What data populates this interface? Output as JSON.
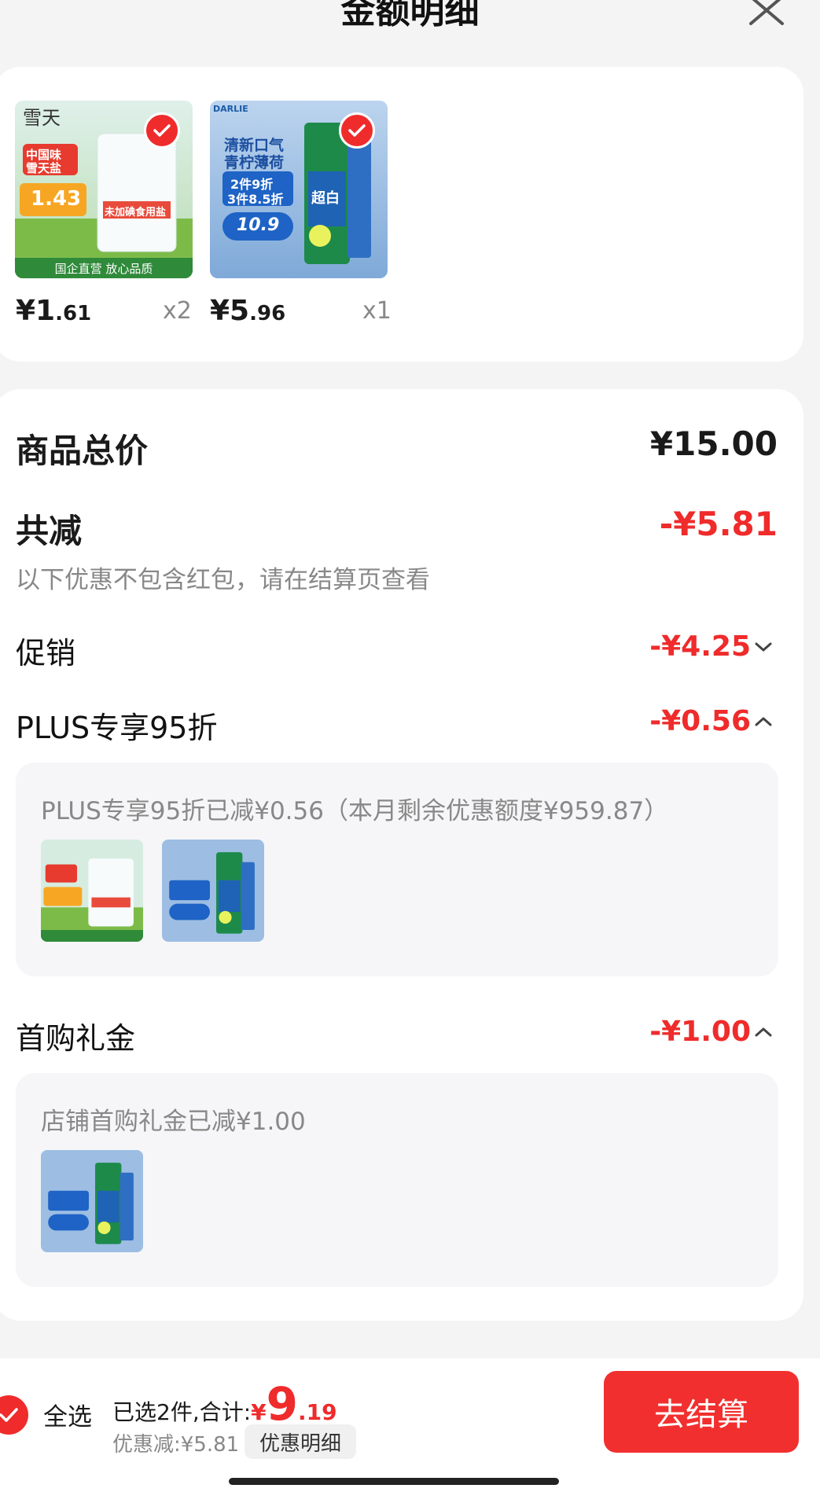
{
  "header": {
    "title": "金额明细"
  },
  "products": [
    {
      "price_int": "¥1",
      "price_dec": ".61",
      "qty": "x2"
    },
    {
      "price_int": "¥5",
      "price_dec": ".96",
      "qty": "x1"
    }
  ],
  "salt_art": {
    "brand": "雪天",
    "badge1": "中国味",
    "badge2": "雪天盐",
    "price": "1.43",
    "label": "未加碘食用盐",
    "footer": "国企直营 放心品质"
  },
  "paste_art": {
    "brand": "DARLIE",
    "line1": "清新口气",
    "line2": "青柠薄荷",
    "deal1": "2件9折",
    "deal2": "3件8.5折",
    "price": "10.9",
    "tube": "超白"
  },
  "summary": {
    "total_label": "商品总价",
    "total_value": "¥15.00",
    "reduce_label": "共减",
    "reduce_value": "-¥5.81",
    "note": "以下优惠不包含红包，请在结算页查看"
  },
  "promo": {
    "label": "促销",
    "value": "-¥4.25"
  },
  "plus": {
    "label": "PLUS专享95折",
    "value": "-¥0.56",
    "detail": "PLUS专享95折已减¥0.56（本月剩余优惠额度¥959.87）"
  },
  "first": {
    "label": "首购礼金",
    "value": "-¥1.00",
    "detail": "店铺首购礼金已减¥1.00"
  },
  "bottom": {
    "select_all": "全选",
    "selected_prefix": "已选2件,合计:",
    "total_symbol": "¥",
    "total_int": "9",
    "total_dec": ".19",
    "discount": "优惠减:¥5.81",
    "detail_btn": "优惠明细",
    "checkout": "去结算"
  },
  "colors": {
    "accent": "#ef2b2b",
    "background": "#f4f4f4"
  }
}
